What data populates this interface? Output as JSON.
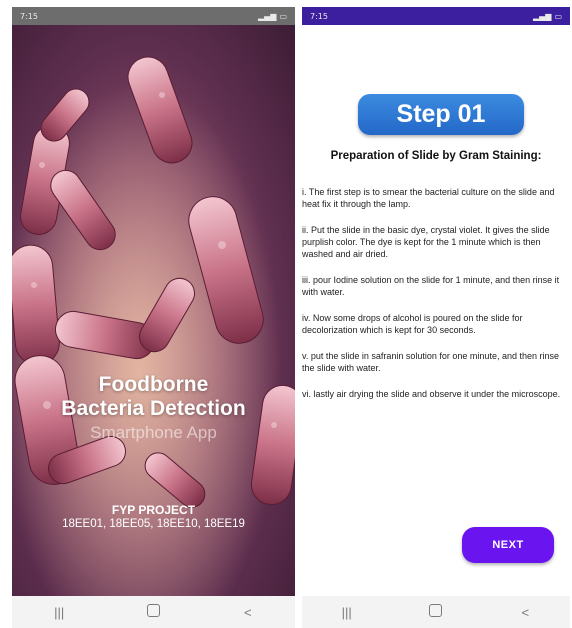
{
  "splash_screen": {
    "status_bar": {
      "time": "7:15"
    },
    "title_line1": "Foodborne",
    "title_line2": "Bacteria Detection",
    "subtitle": "Smartphone App",
    "project_label": "FYP PROJECT",
    "project_ids": "18EE01, 18EE05, 18EE10, 18EE19"
  },
  "step_screen": {
    "status_bar": {
      "time": "7:15"
    },
    "step_title": "Step 01",
    "heading": "Preparation of Slide by Gram Staining:",
    "instructions": [
      "i. The first step is to smear the bacterial culture on the slide and heat fix it through the lamp.",
      "ii. Put the slide in the basic dye, crystal violet. It gives the slide purplish color. The dye is kept for the 1 minute which is then washed and air dried.",
      "iii. pour Iodine solution on the slide for 1 minute, and then rinse it with water.",
      "iv. Now some drops of alcohol is poured on the slide for decolorization which is kept for 30 seconds.",
      "v. put the slide in safranin solution for one minute, and then rinse the slide with water.",
      "vi. lastly air drying the slide and observe it under the microscope."
    ],
    "next_label": "NEXT"
  },
  "navbar": {
    "recents_icon": "recents-icon",
    "home_icon": "home-icon",
    "back_icon": "back-icon",
    "recents_glyph": "|||",
    "back_glyph": "<"
  },
  "colors": {
    "step_button": "#2d75d6",
    "next_button": "#6a14f0",
    "right_status_bar": "#3b1f9e"
  }
}
